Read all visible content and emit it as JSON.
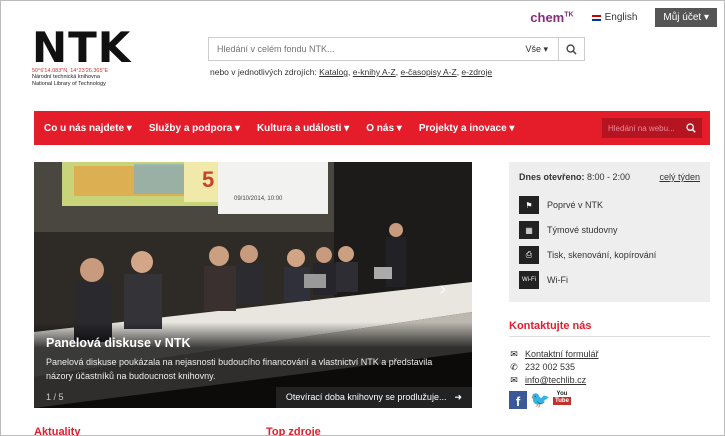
{
  "toplinks": {
    "chem": "chem",
    "chem_sup": "TK",
    "language": "English",
    "account": "Můj účet ▾"
  },
  "logo": {
    "mark": "NTK",
    "coords": "50°6'14.083\"N, 14°23'26.365\"E",
    "name_cz": "Národní technická knihovna",
    "name_en": "National Library of Technology"
  },
  "search": {
    "placeholder": "Hledání v celém fondu NTK...",
    "scope": "Vše ▾",
    "sub_prefix": "nebo v jednotlivých zdrojích: ",
    "sources": [
      "Katalog",
      "e-knihy A-Z",
      "e-časopisy A-Z",
      "e-zdroje"
    ]
  },
  "nav": {
    "items": [
      "Co u nás najdete ▾",
      "Služby a podpora ▾",
      "Kultura a události ▾",
      "O nás ▾",
      "Projekty a inovace ▾"
    ],
    "search_placeholder": "Hledání na webu..."
  },
  "slider": {
    "title": "Panelová diskuse v NTK",
    "text": "Panelová diskuse poukázala na nejasnosti budoucího financování a vlastnictví NTK a představila názory účastníků na budoucnost knihovny.",
    "count": "1 / 5",
    "next_label": "Otevírací doba knihovny se prodlužuje...",
    "next_arrow": "➜",
    "screen_text": "09/10/2014, 10:00"
  },
  "hours": {
    "label": "Dnes otevřeno:",
    "value": "8:00 - 2:00",
    "week_link": "celý týden"
  },
  "services": [
    {
      "icon": "signpost-icon",
      "glyph": "⚑",
      "label": "Poprvé v NTK"
    },
    {
      "icon": "study-room-icon",
      "glyph": "▦",
      "label": "Týmové studovny"
    },
    {
      "icon": "printer-icon",
      "glyph": "⎙",
      "label": "Tisk, skenování, kopírování"
    },
    {
      "icon": "wifi-icon",
      "glyph": "Wi-Fi",
      "label": "Wi-Fi"
    }
  ],
  "contact": {
    "title": "Kontaktujte nás",
    "form": "Kontaktní formulář",
    "phone": "232 002 535",
    "email": "info@techlib.cz"
  },
  "sections": {
    "news": "Aktuality",
    "top": "Top zdroje"
  },
  "colors": {
    "brand_red": "#e51d2b",
    "chem_purple": "#8a2c7c"
  }
}
